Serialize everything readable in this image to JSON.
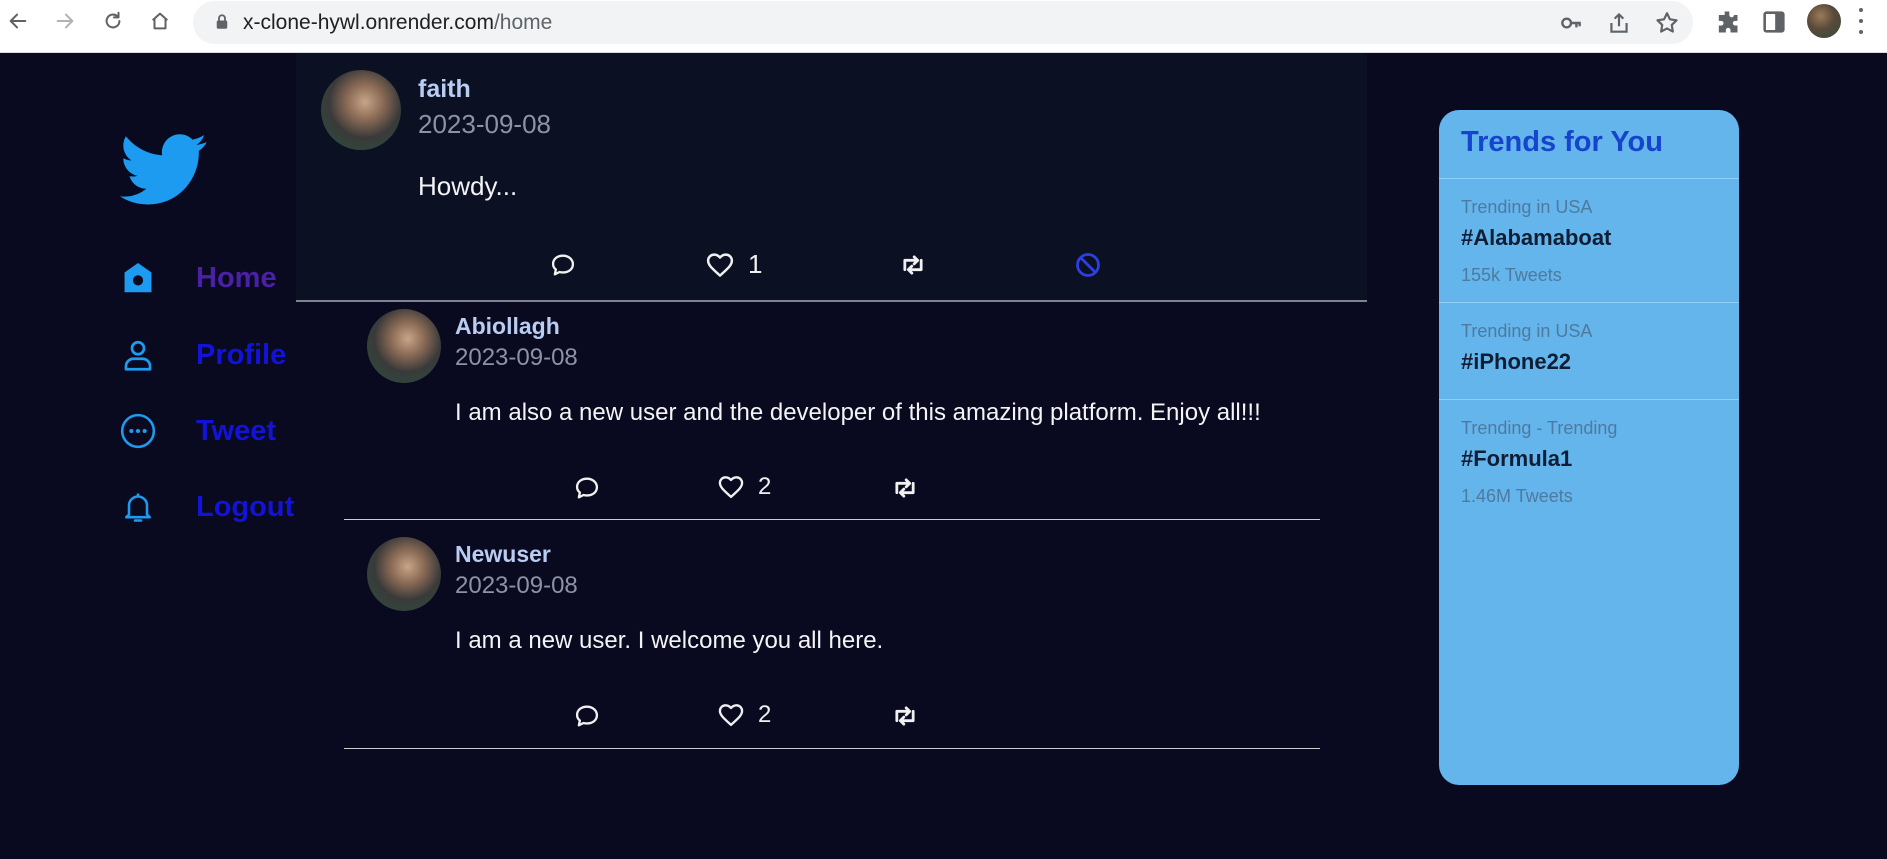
{
  "browser": {
    "url_host": "x-clone-hywl.onrender.com",
    "url_path": "/home"
  },
  "sidebar": {
    "items": [
      {
        "label": "Home",
        "icon": "home-icon",
        "color": "#4a20a6"
      },
      {
        "label": "Profile",
        "icon": "profile-icon",
        "color": "#1212d8"
      },
      {
        "label": "Tweet",
        "icon": "more-icon",
        "color": "#1212d8"
      },
      {
        "label": "Logout",
        "icon": "bell-icon",
        "color": "#1212d8"
      }
    ]
  },
  "feed": {
    "tweets": [
      {
        "username": "faith",
        "date": "2023-09-08",
        "text": "Howdy...",
        "likes": "1"
      },
      {
        "username": "Abiollagh",
        "date": "2023-09-08",
        "text": "I am also a new user and the developer of this amazing platform. Enjoy all!!!",
        "likes": "2"
      },
      {
        "username": "Newuser",
        "date": "2023-09-08",
        "text": "I am a new user. I welcome you all here.",
        "likes": "2"
      }
    ]
  },
  "trends": {
    "title": "Trends for You",
    "items": [
      {
        "category": "Trending in USA",
        "tag": "#Alabamaboat",
        "count": "155k Tweets"
      },
      {
        "category": "Trending in USA",
        "tag": "#iPhone22",
        "count": ""
      },
      {
        "category": "Trending - Trending",
        "tag": "#Formula1",
        "count": "1.46M Tweets"
      }
    ]
  },
  "colors": {
    "background": "#090a1f",
    "accent": "#1d9bf0",
    "trends_panel": "#63b5ec",
    "trends_title": "#1744cc",
    "delete_icon": "#2c3fe0"
  }
}
